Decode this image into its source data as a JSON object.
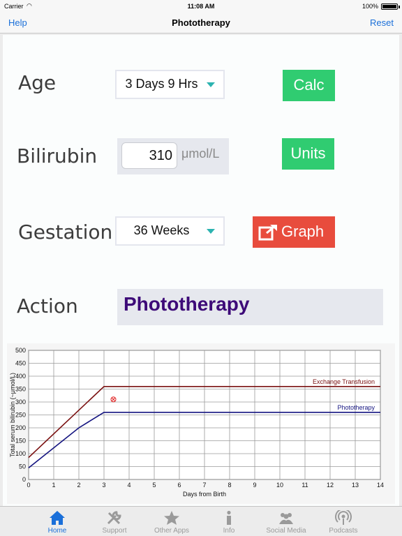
{
  "status": {
    "carrier": "Carrier",
    "time": "11:08 AM",
    "battery": "100%"
  },
  "nav": {
    "left": "Help",
    "title": "Phototherapy",
    "right": "Reset"
  },
  "form": {
    "age_label": "Age",
    "age_value": "3 Days 9 Hrs",
    "calc_label": "Calc",
    "bilirubin_label": "Bilirubin",
    "bilirubin_value": "310",
    "bilirubin_unit": "μmol/L",
    "units_label": "Units",
    "gestation_label": "Gestation",
    "gestation_value": "36 Weeks",
    "graph_label": "Graph",
    "action_label": "Action",
    "action_value": "Phototherapy"
  },
  "colors": {
    "calc_button": "#30cc71",
    "graph_button": "#e84c3d",
    "action_text": "#3d0a78",
    "exchange_line": "#7a1010",
    "phototherapy_line": "#141480",
    "marker": "#e02020"
  },
  "chart_data": {
    "type": "line",
    "xlabel": "Days from Birth",
    "ylabel": "Total serum bilirubin (~μmol/L)",
    "xlim": [
      0,
      14
    ],
    "ylim": [
      0,
      500
    ],
    "xticks": [
      0,
      1,
      2,
      3,
      4,
      5,
      6,
      7,
      8,
      9,
      10,
      11,
      12,
      13,
      14
    ],
    "yticks": [
      0,
      50,
      100,
      150,
      200,
      250,
      300,
      350,
      400,
      450,
      500
    ],
    "grid": true,
    "series": [
      {
        "name": "Exchange Transfusion",
        "x": [
          0,
          3,
          14
        ],
        "y": [
          85,
          360,
          360
        ]
      },
      {
        "name": "Phototherapy",
        "x": [
          0,
          2,
          3,
          14
        ],
        "y": [
          45,
          200,
          260,
          260
        ]
      }
    ],
    "marker_point": {
      "x": 3.375,
      "y": 310
    }
  },
  "tabs": [
    {
      "label": "Home",
      "icon": "home-icon",
      "active": true
    },
    {
      "label": "Support",
      "icon": "wrench-icon",
      "active": false
    },
    {
      "label": "Other Apps",
      "icon": "star-icon",
      "active": false
    },
    {
      "label": "Info",
      "icon": "info-icon",
      "active": false
    },
    {
      "label": "Social Media",
      "icon": "people-icon",
      "active": false
    },
    {
      "label": "Podcasts",
      "icon": "podcast-icon",
      "active": false
    }
  ]
}
